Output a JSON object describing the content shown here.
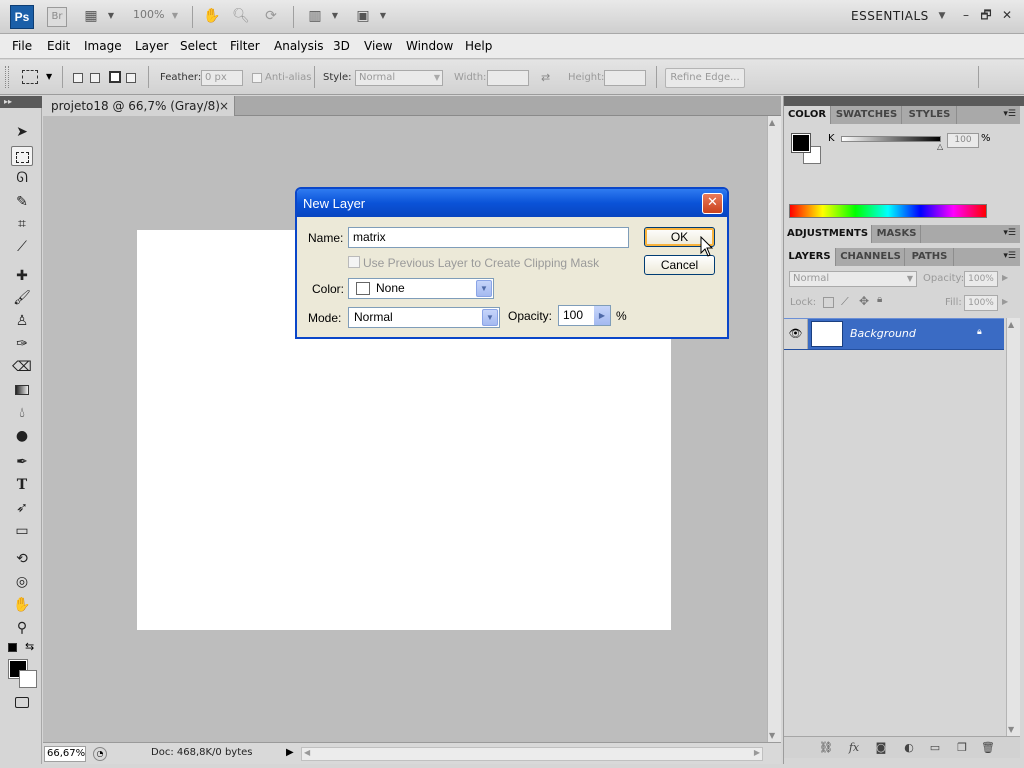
{
  "appbar": {
    "ps_logo": "Ps",
    "br_logo": "Br",
    "zoom": "100%",
    "workspace": "ESSENTIALS",
    "minimize": "–",
    "maximize": "🗗",
    "close": "✕"
  },
  "menu": [
    "File",
    "Edit",
    "Image",
    "Layer",
    "Select",
    "Filter",
    "Analysis",
    "3D",
    "View",
    "Window",
    "Help"
  ],
  "options": {
    "feather_label": "Feather:",
    "feather_value": "0 px",
    "antialias_label": "Anti-alias",
    "style_label": "Style:",
    "style_value": "Normal",
    "width_label": "Width:",
    "height_label": "Height:",
    "refine_edge": "Refine Edge..."
  },
  "document": {
    "tab_title": "projeto18 @ 66,7% (Gray/8)",
    "tab_close": "×",
    "zoom": "66,67%",
    "doc_info": "Doc: 468,8K/0 bytes"
  },
  "color_panel": {
    "tabs": [
      "COLOR",
      "SWATCHES",
      "STYLES"
    ],
    "channel_label": "K",
    "channel_value": "100",
    "unit": "%",
    "fg_color": "#000000",
    "bg_color": "#ffffff"
  },
  "adjust_panel": {
    "tabs": [
      "ADJUSTMENTS",
      "MASKS"
    ]
  },
  "layers_panel": {
    "tabs": [
      "LAYERS",
      "CHANNELS",
      "PATHS"
    ],
    "blend_mode": "Normal",
    "opacity_label": "Opacity:",
    "opacity_value": "100%",
    "lock_label": "Lock:",
    "fill_label": "Fill:",
    "fill_value": "100%",
    "layers": [
      {
        "name": "Background",
        "selected": true,
        "locked": true
      }
    ]
  },
  "dialog": {
    "title": "New Layer",
    "name_label": "Name:",
    "name_value": "matrix",
    "clipping_label": "Use Previous Layer to Create Clipping Mask",
    "color_label": "Color:",
    "color_value": "None",
    "mode_label": "Mode:",
    "mode_value": "Normal",
    "opacity_label": "Opacity:",
    "opacity_value": "100",
    "opacity_unit": "%",
    "ok": "OK",
    "cancel": "Cancel",
    "close": "✕"
  },
  "colors": {
    "accent_blue": "#0a53d8",
    "layer_selected": "#3a6bc4",
    "dialog_bg": "#ece9d8"
  }
}
